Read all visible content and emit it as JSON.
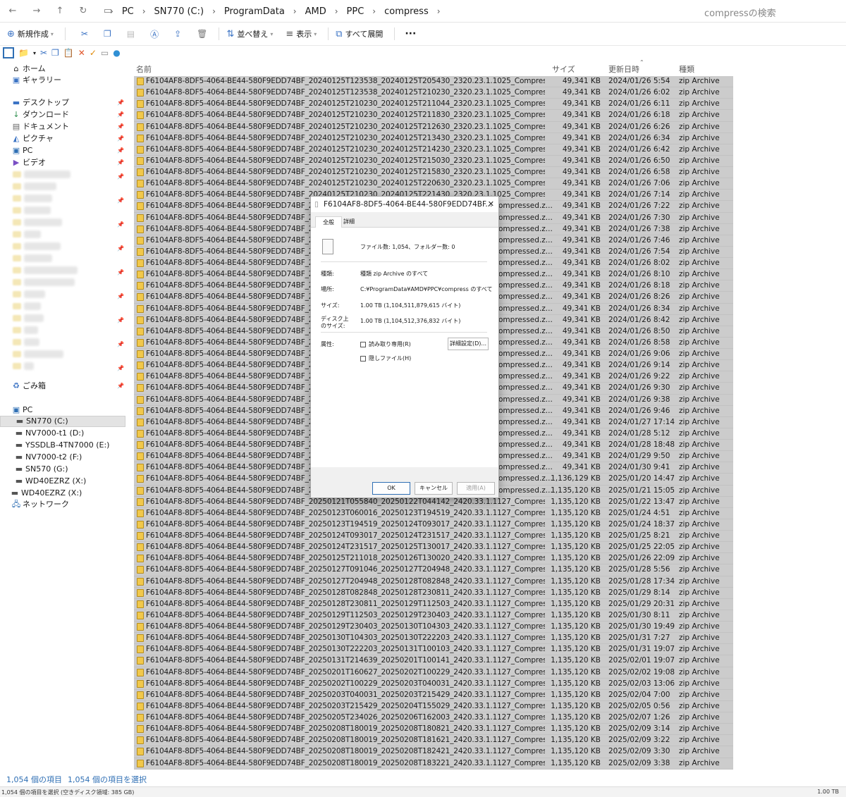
{
  "address": {
    "crumbs": [
      "PC",
      "SN770 (C:)",
      "ProgramData",
      "AMD",
      "PPC",
      "compress"
    ],
    "search_placeholder": "compressの検索"
  },
  "toolbar": {
    "new": "新規作成",
    "sort": "並べ替え",
    "view": "表示",
    "expand_all": "すべて展開",
    "more": "···"
  },
  "nav": {
    "home": "ホーム",
    "gallery": "ギャラリー",
    "desktop": "デスクトップ",
    "downloads": "ダウンロード",
    "documents": "ドキュメント",
    "pictures": "ピクチャ",
    "pc_pinned": "PC",
    "videos": "ビデオ",
    "trash": "ごみ箱",
    "pc": "PC",
    "drives": [
      "SN770 (C:)",
      "NV7000-t1 (D:)",
      "YSSDLB-4TN7000 (E:)",
      "NV7000-t2 (F:)",
      "SN570 (G:)",
      "WD40EZRZ (X:)"
    ],
    "drive_x2": "WD40EZRZ (X:)",
    "network": "ネットワーク"
  },
  "columns": {
    "name": "名前",
    "size": "サイズ",
    "date": "更新日時",
    "type": "種類"
  },
  "files": [
    {
      "name": "F6104AF8-8DF5-4064-BE44-580F9EDD74BF_20240125T123538_20240125T205430_2320.23.1.1025_Compressed.z...",
      "size": "49,341 KB",
      "date": "2024/01/26 5:54",
      "type": "zip Archive"
    },
    {
      "name": "F6104AF8-8DF5-4064-BE44-580F9EDD74BF_20240125T123538_20240125T210230_2320.23.1.1025_Compressed.z...",
      "size": "49,341 KB",
      "date": "2024/01/26 6:02",
      "type": "zip Archive"
    },
    {
      "name": "F6104AF8-8DF5-4064-BE44-580F9EDD74BF_20240125T210230_20240125T211044_2320.23.1.1025_Compressed.z...",
      "size": "49,341 KB",
      "date": "2024/01/26 6:11",
      "type": "zip Archive"
    },
    {
      "name": "F6104AF8-8DF5-4064-BE44-580F9EDD74BF_20240125T210230_20240125T211830_2320.23.1.1025_Compressed.z...",
      "size": "49,341 KB",
      "date": "2024/01/26 6:18",
      "type": "zip Archive"
    },
    {
      "name": "F6104AF8-8DF5-4064-BE44-580F9EDD74BF_20240125T210230_20240125T212630_2320.23.1.1025_Compressed.z...",
      "size": "49,341 KB",
      "date": "2024/01/26 6:26",
      "type": "zip Archive"
    },
    {
      "name": "F6104AF8-8DF5-4064-BE44-580F9EDD74BF_20240125T210230_20240125T213430_2320.23.1.1025_Compressed.z...",
      "size": "49,341 KB",
      "date": "2024/01/26 6:34",
      "type": "zip Archive"
    },
    {
      "name": "F6104AF8-8DF5-4064-BE44-580F9EDD74BF_20240125T210230_20240125T214230_2320.23.1.1025_Compressed.z...",
      "size": "49,341 KB",
      "date": "2024/01/26 6:42",
      "type": "zip Archive"
    },
    {
      "name": "F6104AF8-8DF5-4064-BE44-580F9EDD74BF_20240125T210230_20240125T215030_2320.23.1.1025_Compressed.z...",
      "size": "49,341 KB",
      "date": "2024/01/26 6:50",
      "type": "zip Archive"
    },
    {
      "name": "F6104AF8-8DF5-4064-BE44-580F9EDD74BF_20240125T210230_20240125T215830_2320.23.1.1025_Compressed.z...",
      "size": "49,341 KB",
      "date": "2024/01/26 6:58",
      "type": "zip Archive"
    },
    {
      "name": "F6104AF8-8DF5-4064-BE44-580F9EDD74BF_20240125T210230_20240125T220630_2320.23.1.1025_Compressed.z...",
      "size": "49,341 KB",
      "date": "2024/01/26 7:06",
      "type": "zip Archive"
    },
    {
      "name": "F6104AF8-8DF5-4064-BE44-580F9EDD74BF_20240125T210230_20240125T221430_2320.23.1.1025_Compressed.z...",
      "size": "49,341 KB",
      "date": "2024/01/26 7:14",
      "type": "zip Archive"
    },
    {
      "name": "F6104AF8-8DF5-4064-BE44-580F9EDD74BF_20",
      "size": "49,341 KB",
      "date": "2024/01/26 7:22",
      "type": "zip Archive",
      "tail": "ompressed.z..."
    },
    {
      "name": "F6104AF8-8DF5-4064-BE44-580F9EDD74BF_20",
      "size": "49,341 KB",
      "date": "2024/01/26 7:30",
      "type": "zip Archive",
      "tail": "ompressed.z..."
    },
    {
      "name": "F6104AF8-8DF5-4064-BE44-580F9EDD74BF_20",
      "size": "49,341 KB",
      "date": "2024/01/26 7:38",
      "type": "zip Archive",
      "tail": "ompressed.z..."
    },
    {
      "name": "F6104AF8-8DF5-4064-BE44-580F9EDD74BF_20",
      "size": "49,341 KB",
      "date": "2024/01/26 7:46",
      "type": "zip Archive",
      "tail": "ompressed.z..."
    },
    {
      "name": "F6104AF8-8DF5-4064-BE44-580F9EDD74BF_20",
      "size": "49,341 KB",
      "date": "2024/01/26 7:54",
      "type": "zip Archive",
      "tail": "ompressed.z..."
    },
    {
      "name": "F6104AF8-8DF5-4064-BE44-580F9EDD74BF_20",
      "size": "49,341 KB",
      "date": "2024/01/26 8:02",
      "type": "zip Archive",
      "tail": "ompressed.z..."
    },
    {
      "name": "F6104AF8-8DF5-4064-BE44-580F9EDD74BF_20",
      "size": "49,341 KB",
      "date": "2024/01/26 8:10",
      "type": "zip Archive",
      "tail": "ompressed.z..."
    },
    {
      "name": "F6104AF8-8DF5-4064-BE44-580F9EDD74BF_20",
      "size": "49,341 KB",
      "date": "2024/01/26 8:18",
      "type": "zip Archive",
      "tail": "ompressed.z..."
    },
    {
      "name": "F6104AF8-8DF5-4064-BE44-580F9EDD74BF_20",
      "size": "49,341 KB",
      "date": "2024/01/26 8:26",
      "type": "zip Archive",
      "tail": "ompressed.z..."
    },
    {
      "name": "F6104AF8-8DF5-4064-BE44-580F9EDD74BF_20",
      "size": "49,341 KB",
      "date": "2024/01/26 8:34",
      "type": "zip Archive",
      "tail": "ompressed.z..."
    },
    {
      "name": "F6104AF8-8DF5-4064-BE44-580F9EDD74BF_20",
      "size": "49,341 KB",
      "date": "2024/01/26 8:42",
      "type": "zip Archive",
      "tail": "ompressed.z..."
    },
    {
      "name": "F6104AF8-8DF5-4064-BE44-580F9EDD74BF_20",
      "size": "49,341 KB",
      "date": "2024/01/26 8:50",
      "type": "zip Archive",
      "tail": "ompressed.z..."
    },
    {
      "name": "F6104AF8-8DF5-4064-BE44-580F9EDD74BF_20",
      "size": "49,341 KB",
      "date": "2024/01/26 8:58",
      "type": "zip Archive",
      "tail": "ompressed.z..."
    },
    {
      "name": "F6104AF8-8DF5-4064-BE44-580F9EDD74BF_20",
      "size": "49,341 KB",
      "date": "2024/01/26 9:06",
      "type": "zip Archive",
      "tail": "ompressed.z..."
    },
    {
      "name": "F6104AF8-8DF5-4064-BE44-580F9EDD74BF_20",
      "size": "49,341 KB",
      "date": "2024/01/26 9:14",
      "type": "zip Archive",
      "tail": "ompressed.z..."
    },
    {
      "name": "F6104AF8-8DF5-4064-BE44-580F9EDD74BF_20",
      "size": "49,341 KB",
      "date": "2024/01/26 9:22",
      "type": "zip Archive",
      "tail": "ompressed.z..."
    },
    {
      "name": "F6104AF8-8DF5-4064-BE44-580F9EDD74BF_20",
      "size": "49,341 KB",
      "date": "2024/01/26 9:30",
      "type": "zip Archive",
      "tail": "ompressed.z..."
    },
    {
      "name": "F6104AF8-8DF5-4064-BE44-580F9EDD74BF_20",
      "size": "49,341 KB",
      "date": "2024/01/26 9:38",
      "type": "zip Archive",
      "tail": "ompressed.z..."
    },
    {
      "name": "F6104AF8-8DF5-4064-BE44-580F9EDD74BF_20",
      "size": "49,341 KB",
      "date": "2024/01/26 9:46",
      "type": "zip Archive",
      "tail": "ompressed.z..."
    },
    {
      "name": "F6104AF8-8DF5-4064-BE44-580F9EDD74BF_20",
      "size": "49,341 KB",
      "date": "2024/01/27 17:14",
      "type": "zip Archive",
      "tail": "ompressed.z..."
    },
    {
      "name": "F6104AF8-8DF5-4064-BE44-580F9EDD74BF_20",
      "size": "49,341 KB",
      "date": "2024/01/28 5:12",
      "type": "zip Archive",
      "tail": "ompressed.z..."
    },
    {
      "name": "F6104AF8-8DF5-4064-BE44-580F9EDD74BF_20",
      "size": "49,341 KB",
      "date": "2024/01/28 18:48",
      "type": "zip Archive",
      "tail": "ompressed.z..."
    },
    {
      "name": "F6104AF8-8DF5-4064-BE44-580F9EDD74BF_20",
      "size": "49,341 KB",
      "date": "2024/01/29 9:50",
      "type": "zip Archive",
      "tail": "ompressed.z..."
    },
    {
      "name": "F6104AF8-8DF5-4064-BE44-580F9EDD74BF_20",
      "size": "49,341 KB",
      "date": "2024/01/30 9:41",
      "type": "zip Archive",
      "tail": "ompressed.z..."
    },
    {
      "name": "F6104AF8-8DF5-4064-BE44-580F9EDD74BF_20",
      "size": "1,136,129 KB",
      "date": "2025/01/20 14:47",
      "type": "zip Archive",
      "tail": "ompressed.z..."
    },
    {
      "name": "F6104AF8-8DF5-4064-BE44-580F9EDD74BF_20",
      "size": "1,135,120 KB",
      "date": "2025/01/21 15:05",
      "type": "zip Archive",
      "tail": "ompressed.z..."
    },
    {
      "name": "F6104AF8-8DF5-4064-BE44-580F9EDD74BF_20250121T055840_20250122T044142_2420.33.1.1127_Compressed.z...",
      "size": "1,135,120 KB",
      "date": "2025/01/22 13:47",
      "type": "zip Archive"
    },
    {
      "name": "F6104AF8-8DF5-4064-BE44-580F9EDD74BF_20250123T060016_20250123T194519_2420.33.1.1127_Compressed.z...",
      "size": "1,135,120 KB",
      "date": "2025/01/24 4:51",
      "type": "zip Archive"
    },
    {
      "name": "F6104AF8-8DF5-4064-BE44-580F9EDD74BF_20250123T194519_20250124T093017_2420.33.1.1127_Compressed.z...",
      "size": "1,135,120 KB",
      "date": "2025/01/24 18:37",
      "type": "zip Archive"
    },
    {
      "name": "F6104AF8-8DF5-4064-BE44-580F9EDD74BF_20250124T093017_20250124T231517_2420.33.1.1127_Compressed.z...",
      "size": "1,135,120 KB",
      "date": "2025/01/25 8:21",
      "type": "zip Archive"
    },
    {
      "name": "F6104AF8-8DF5-4064-BE44-580F9EDD74BF_20250124T231517_20250125T130017_2420.33.1.1127_Compressed.z...",
      "size": "1,135,120 KB",
      "date": "2025/01/25 22:05",
      "type": "zip Archive"
    },
    {
      "name": "F6104AF8-8DF5-4064-BE44-580F9EDD74BF_20250125T211018_20250126T130020_2420.33.1.1127_Compressed.z...",
      "size": "1,135,120 KB",
      "date": "2025/01/26 22:09",
      "type": "zip Archive"
    },
    {
      "name": "F6104AF8-8DF5-4064-BE44-580F9EDD74BF_20250127T091046_20250127T204948_2420.33.1.1127_Compressed.z...",
      "size": "1,135,120 KB",
      "date": "2025/01/28 5:56",
      "type": "zip Archive"
    },
    {
      "name": "F6104AF8-8DF5-4064-BE44-580F9EDD74BF_20250127T204948_20250128T082848_2420.33.1.1127_Compressed.z...",
      "size": "1,135,120 KB",
      "date": "2025/01/28 17:34",
      "type": "zip Archive"
    },
    {
      "name": "F6104AF8-8DF5-4064-BE44-580F9EDD74BF_20250128T082848_20250128T230811_2420.33.1.1127_Compressed.z...",
      "size": "1,135,120 KB",
      "date": "2025/01/29 8:14",
      "type": "zip Archive"
    },
    {
      "name": "F6104AF8-8DF5-4064-BE44-580F9EDD74BF_20250128T230811_20250129T112503_2420.33.1.1127_Compressed.z...",
      "size": "1,135,120 KB",
      "date": "2025/01/29 20:31",
      "type": "zip Archive"
    },
    {
      "name": "F6104AF8-8DF5-4064-BE44-580F9EDD74BF_20250129T112503_20250129T230403_2420.33.1.1127_Compressed.z...",
      "size": "1,135,120 KB",
      "date": "2025/01/30 8:11",
      "type": "zip Archive"
    },
    {
      "name": "F6104AF8-8DF5-4064-BE44-580F9EDD74BF_20250129T230403_20250130T104303_2420.33.1.1127_Compressed.z...",
      "size": "1,135,120 KB",
      "date": "2025/01/30 19:49",
      "type": "zip Archive"
    },
    {
      "name": "F6104AF8-8DF5-4064-BE44-580F9EDD74BF_20250130T104303_20250130T222203_2420.33.1.1127_Compressed.z...",
      "size": "1,135,120 KB",
      "date": "2025/01/31 7:27",
      "type": "zip Archive"
    },
    {
      "name": "F6104AF8-8DF5-4064-BE44-580F9EDD74BF_20250130T222203_20250131T100103_2420.33.1.1127_Compressed.z...",
      "size": "1,135,120 KB",
      "date": "2025/01/31 19:07",
      "type": "zip Archive"
    },
    {
      "name": "F6104AF8-8DF5-4064-BE44-580F9EDD74BF_20250131T214639_20250201T100141_2420.33.1.1127_Compressed.z...",
      "size": "1,135,120 KB",
      "date": "2025/02/01 19:07",
      "type": "zip Archive"
    },
    {
      "name": "F6104AF8-8DF5-4064-BE44-580F9EDD74BF_20250201T160627_20250202T100229_2420.33.1.1127_Compressed.z...",
      "size": "1,135,120 KB",
      "date": "2025/02/02 19:08",
      "type": "zip Archive"
    },
    {
      "name": "F6104AF8-8DF5-4064-BE44-580F9EDD74BF_20250202T100229_20250203T040031_2420.33.1.1127_Compressed.z...",
      "size": "1,135,120 KB",
      "date": "2025/02/03 13:06",
      "type": "zip Archive"
    },
    {
      "name": "F6104AF8-8DF5-4064-BE44-580F9EDD74BF_20250203T040031_20250203T215429_2420.33.1.1127_Compressed.z...",
      "size": "1,135,120 KB",
      "date": "2025/02/04 7:00",
      "type": "zip Archive"
    },
    {
      "name": "F6104AF8-8DF5-4064-BE44-580F9EDD74BF_20250203T215429_20250204T155029_2420.33.1.1127_Compressed.z...",
      "size": "1,135,120 KB",
      "date": "2025/02/05 0:56",
      "type": "zip Archive"
    },
    {
      "name": "F6104AF8-8DF5-4064-BE44-580F9EDD74BF_20250205T234026_20250206T162003_2420.33.1.1127_Compressed.z...",
      "size": "1,135,120 KB",
      "date": "2025/02/07 1:26",
      "type": "zip Archive"
    },
    {
      "name": "F6104AF8-8DF5-4064-BE44-580F9EDD74BF_20250208T180019_20250208T180821_2420.33.1.1127_Compressed.z...",
      "size": "1,135,120 KB",
      "date": "2025/02/09 3:14",
      "type": "zip Archive"
    },
    {
      "name": "F6104AF8-8DF5-4064-BE44-580F9EDD74BF_20250208T180019_20250208T181621_2420.33.1.1127_Compressed.z...",
      "size": "1,135,120 KB",
      "date": "2025/02/09 3:22",
      "type": "zip Archive"
    },
    {
      "name": "F6104AF8-8DF5-4064-BE44-580F9EDD74BF_20250208T180019_20250208T182421_2420.33.1.1127_Compressed.z...",
      "size": "1,135,120 KB",
      "date": "2025/02/09 3:30",
      "type": "zip Archive"
    },
    {
      "name": "F6104AF8-8DF5-4064-BE44-580F9EDD74BF_20250208T180019_20250208T183221_2420.33.1.1127_Compressed.z...",
      "size": "1,135,120 KB",
      "date": "2025/02/09 3:38",
      "type": "zip Archive"
    }
  ],
  "status": {
    "count": "1,054 個の項目",
    "selected": "1,054 個の項目を選択",
    "bottom_left": "1,054 個の項目を選択 (空きディスク領域: 385 GB)",
    "bottom_right": "1.00 TB"
  },
  "dialog": {
    "title": "F6104AF8-8DF5-4064-BE44-580F9EDD74BF...",
    "tab_general": "全般",
    "tab_details": "詳細",
    "file_count": "ファイル数: 1,054、フォルダー数: 0",
    "type_label": "種類:",
    "type_value": "種類 zip Archive のすべて",
    "location_label": "場所:",
    "location_value": "C:¥ProgramData¥AMD¥PPC¥compress のすべて",
    "size_label": "サイズ:",
    "size_value": "1.00 TB (1,104,511,879,615 バイト)",
    "disk_label_1": "ディスク上",
    "disk_label_2": "のサイズ:",
    "disk_value": "1.00 TB (1,104,512,376,832 バイト)",
    "attr_label": "属性:",
    "readonly": "読み取り専用(R)",
    "hidden": "隠しファイル(H)",
    "advanced": "詳細設定(D)...",
    "ok": "OK",
    "cancel": "キャンセル",
    "apply": "適用(A)"
  }
}
